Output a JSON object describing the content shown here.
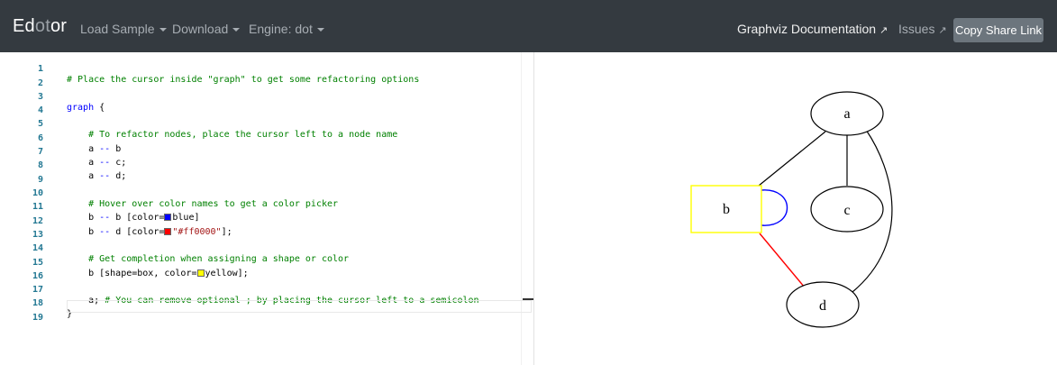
{
  "navbar": {
    "brand_main": "Ed",
    "brand_dim": "ot",
    "brand_end": "or",
    "load_sample": "Load Sample",
    "download": "Download",
    "engine": "Engine: dot",
    "docs": "Graphviz Documentation",
    "issues": "Issues",
    "share": "Copy Share Link",
    "external_glyph": "↗"
  },
  "editor": {
    "line_numbers": [
      "1",
      "2",
      "3",
      "4",
      "5",
      "6",
      "7",
      "8",
      "9",
      "10",
      "11",
      "12",
      "13",
      "14",
      "15",
      "16",
      "17",
      "18",
      "19"
    ],
    "lines": {
      "l1": "# Place the cursor inside \"graph\" to get some refactoring options",
      "l3_kw": "graph",
      "l3_rest": " {",
      "l5": "    # To refactor nodes, place the cursor left to a node name",
      "l6_a": "    a ",
      "l6_op": "--",
      "l6_b": " b",
      "l7_a": "    a ",
      "l7_op": "--",
      "l7_b": " c;",
      "l8_a": "    a ",
      "l8_op": "--",
      "l8_b": " d;",
      "l10": "    # Hover over color names to get a color picker",
      "l11_a": "    b ",
      "l11_op": "--",
      "l11_b": " b [color=",
      "l11_val": "blue",
      "l11_end": "]",
      "l12_a": "    b ",
      "l12_op": "--",
      "l12_b": " d [color=",
      "l12_val": "\"#ff0000\"",
      "l12_end": "];",
      "l14": "    # Get completion when assigning a shape or color",
      "l15_a": "    b [shape=box, color=",
      "l15_val": "yellow",
      "l15_end": "];",
      "l17_a": "    a; ",
      "l17_cm": "# You can remove optional ; by placing the cursor left to a semicolon",
      "l18": "}"
    },
    "swatches": {
      "blue": "#0000ff",
      "red": "#ff0000",
      "yellow": "#ffff00"
    }
  },
  "graph": {
    "nodes": [
      "a",
      "b",
      "c",
      "d"
    ],
    "edge_colors": {
      "b_b": "#0000ff",
      "b_d": "#ff0000",
      "default": "#000000"
    },
    "box_color": "#ffff00"
  }
}
